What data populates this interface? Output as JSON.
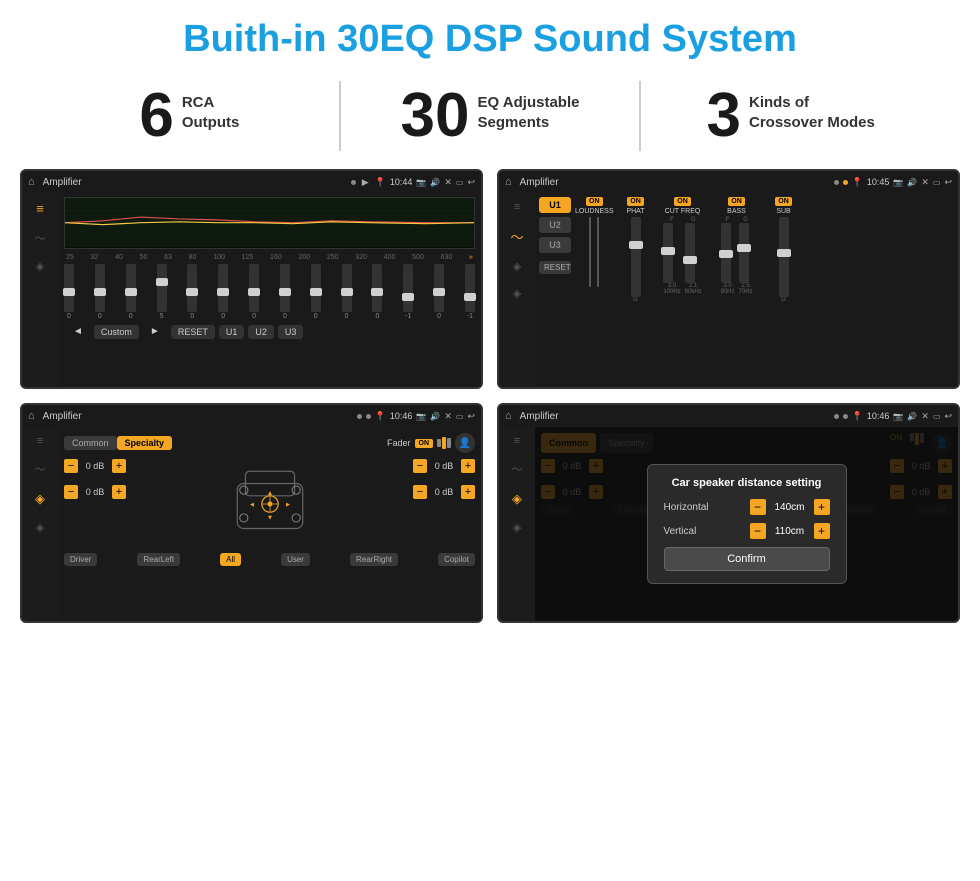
{
  "header": {
    "title": "Buith-in 30EQ DSP Sound System"
  },
  "stats": [
    {
      "number": "6",
      "text": "RCA\nOutputs"
    },
    {
      "number": "30",
      "text": "EQ Adjustable\nSegments"
    },
    {
      "number": "3",
      "text": "Kinds of\nCrossover Modes"
    }
  ],
  "screens": [
    {
      "id": "screen1",
      "topbar": {
        "title": "Amplifier",
        "time": "10:44",
        "dots": [
          "gray",
          "gray"
        ]
      },
      "eq": {
        "freqs": [
          "25",
          "32",
          "40",
          "50",
          "63",
          "80",
          "100",
          "125",
          "160",
          "200",
          "250",
          "320",
          "400",
          "500",
          "630"
        ],
        "values": [
          "0",
          "0",
          "0",
          "5",
          "0",
          "0",
          "0",
          "0",
          "0",
          "0",
          "0",
          "-1",
          "0",
          "-1"
        ],
        "preset": "Custom",
        "buttons": [
          "RESET",
          "U1",
          "U2",
          "U3"
        ]
      }
    },
    {
      "id": "screen2",
      "topbar": {
        "title": "Amplifier",
        "time": "10:45",
        "dots": [
          "gray",
          "orange"
        ]
      },
      "presets": [
        "U1",
        "U2",
        "U3"
      ],
      "controls": [
        {
          "label": "LOUDNESS",
          "on": true
        },
        {
          "label": "PHAT",
          "on": true
        },
        {
          "label": "CUT FREQ",
          "on": true
        },
        {
          "label": "BASS",
          "on": true
        },
        {
          "label": "SUB",
          "on": true
        }
      ]
    },
    {
      "id": "screen3",
      "topbar": {
        "title": "Amplifier",
        "time": "10:46",
        "dots": [
          "gray",
          "gray"
        ]
      },
      "tabs": [
        "Common",
        "Specialty"
      ],
      "activeTab": 1,
      "fader": {
        "label": "Fader",
        "on": true
      },
      "channels": [
        {
          "db": "0 dB",
          "db2": "0 dB"
        },
        {
          "db": "0 dB",
          "db2": "0 dB"
        }
      ],
      "bottomBtns": [
        "Driver",
        "RearLeft",
        "All",
        "User",
        "RearRight",
        "Copilot"
      ]
    },
    {
      "id": "screen4",
      "topbar": {
        "title": "Amplifier",
        "time": "10:46",
        "dots": [
          "gray",
          "gray"
        ]
      },
      "tabs": [
        "Common",
        "Specialty"
      ],
      "activeTab": 0,
      "dialog": {
        "title": "Car speaker distance setting",
        "horizontal": {
          "label": "Horizontal",
          "value": "140cm"
        },
        "vertical": {
          "label": "Vertical",
          "value": "110cm"
        },
        "confirmBtn": "Confirm"
      },
      "channels": [
        {
          "db": "0 dB"
        },
        {
          "db": "0 dB"
        }
      ],
      "bottomBtns": [
        "Driver",
        "RearLeft",
        "All",
        "User",
        "RearRight",
        "Copilot"
      ]
    }
  ],
  "icons": {
    "home": "⌂",
    "back": "↩",
    "eq_icon": "≡",
    "wave_icon": "〜",
    "speaker": "◉",
    "pin": "📍",
    "cam": "📷",
    "vol": "🔊",
    "close": "✕",
    "window": "▭",
    "user": "👤",
    "arrow_left": "◄",
    "arrow_right": "►",
    "arrow_up": "▲",
    "arrow_down": "▼",
    "minus": "−",
    "plus": "+"
  }
}
